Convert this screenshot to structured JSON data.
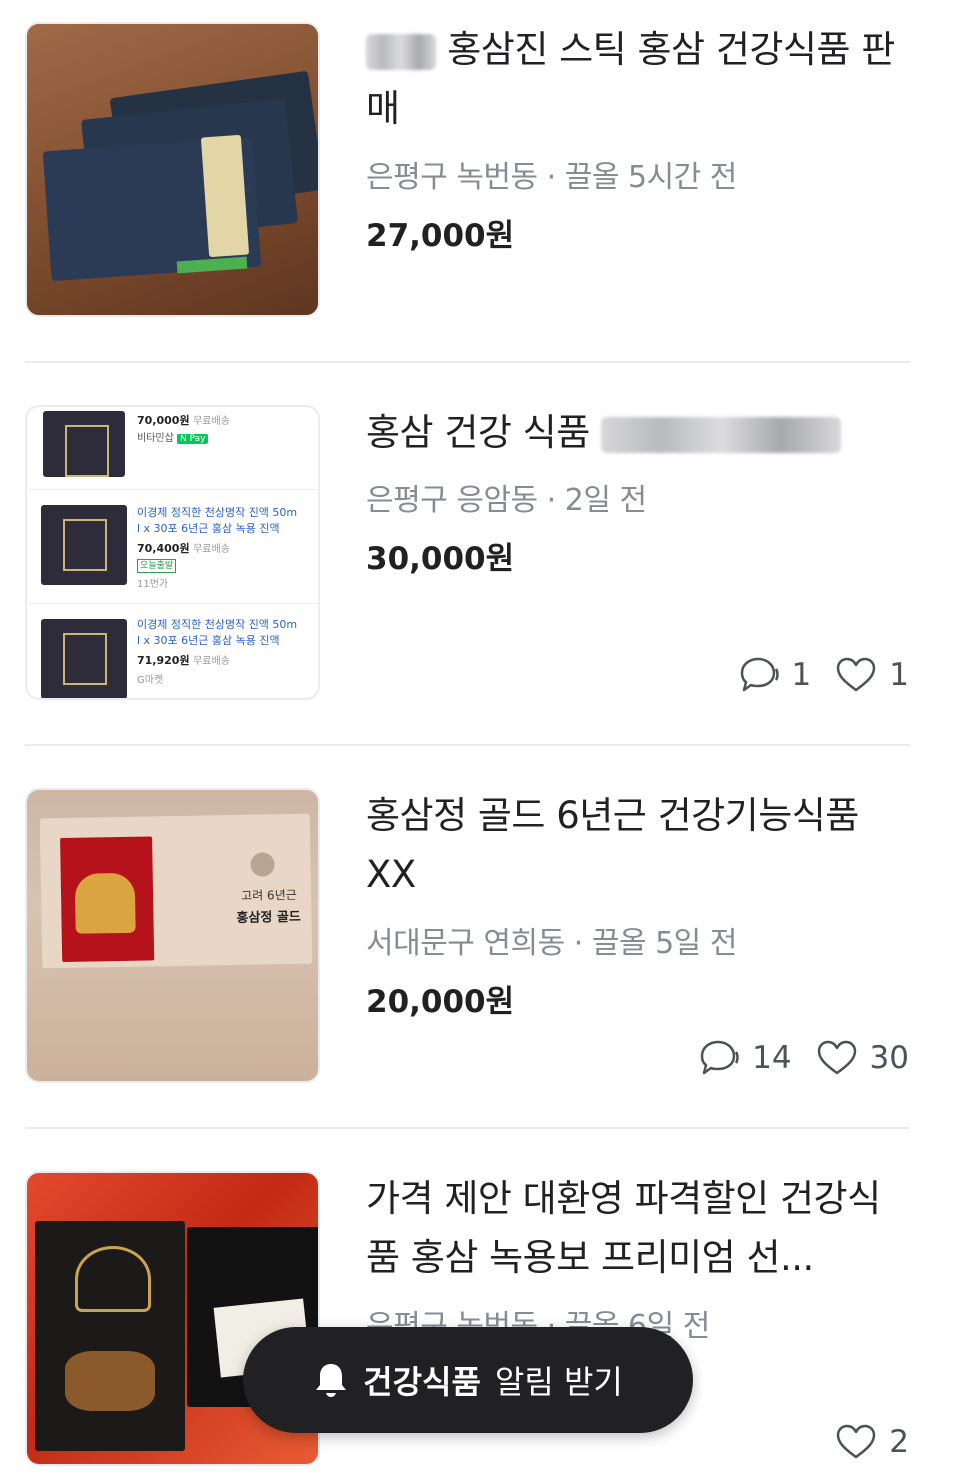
{
  "listings": [
    {
      "title_prefix_redacted": true,
      "title": "홍삼진 스틱 홍삼 건강식품 판매",
      "location": "은평구 녹번동",
      "time": "끌올 5시간 전",
      "price": "27,000원"
    },
    {
      "title": "홍삼 건강 식품",
      "title_suffix_redacted": true,
      "location": "은평구 응암동",
      "time": "2일 전",
      "price": "30,000원",
      "chats": "1",
      "likes": "1",
      "thumbnail_text": {
        "r1_price": "70,000원",
        "r1_ship": "무료배송",
        "r1_seller": "비타민삽",
        "r1_pay": "N Pay",
        "r2_title_a": "이경제 정직한 천상명작 진액 50m",
        "r2_title_b": "l x 30포 6년근 홍삼 녹용 진액",
        "r2_price": "70,400원",
        "r2_ship": "무료배송",
        "r2_badge": "오늘출발",
        "r2_seller": "11번가",
        "r3_title_a": "이경제 정직한 천상명작 진액 50m",
        "r3_title_b": "l x 30포 6년근 홍삼 녹용 진액",
        "r3_price": "71,920원",
        "r3_ship": "무료배송",
        "r3_seller": "G마켓"
      }
    },
    {
      "title": "홍삼정 골드 6년근 건강기능식품 XX",
      "location": "서대문구 연희동",
      "time": "끌올 5일 전",
      "price": "20,000원",
      "chats": "14",
      "likes": "30",
      "thumbnail_text": {
        "line1": "고려 6년근",
        "line2": "홍삼정 골드"
      }
    },
    {
      "title": "가격 제안 대환영 파격할인 건강식품 홍삼 녹용보 프리미엄 선...",
      "location": "은평구 녹번동",
      "time": "끌올 6일 전",
      "likes": "2"
    }
  ],
  "alert_button": {
    "keyword": "건강식품",
    "label": "알림 받기"
  },
  "icons": {
    "chat": "chat-bubble-icon",
    "like": "heart-icon",
    "alert": "bell-icon"
  },
  "colors": {
    "text": "#212124",
    "meta": "#868b94",
    "button_bg": "#212124",
    "divider": "#eaebee"
  }
}
